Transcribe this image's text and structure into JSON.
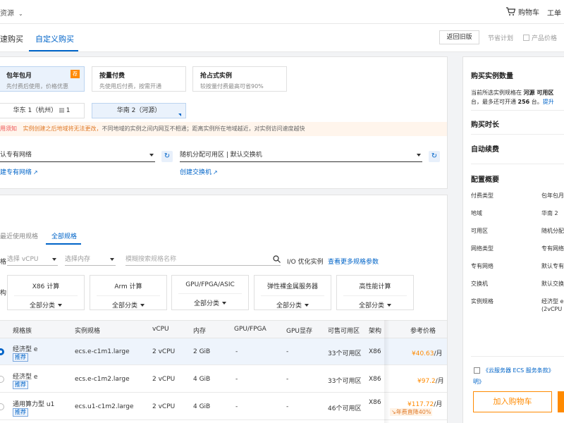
{
  "topbar": {
    "resource_label": "资源",
    "cart_label": "购物车",
    "work_label": "工单"
  },
  "tabs": {
    "quick_buy": "速购买",
    "custom_buy": "自定义购买",
    "back_old": "返回旧版",
    "saving_plan": "节省计划",
    "product_price": "产品价格"
  },
  "billing": {
    "options": [
      {
        "title": "包年包月",
        "subtitle": "先付费后使用，价格优惠",
        "badge": "荐"
      },
      {
        "title": "按量付费",
        "subtitle": "先使用后付费，按需开通"
      },
      {
        "title": "抢占式实例",
        "subtitle": "较按量付费最高可省90%"
      }
    ]
  },
  "regions": {
    "east1": "华东 1（杭州）",
    "east1_badge": "1",
    "south2": "华南 2（河源）"
  },
  "notice": {
    "label": "用须知",
    "warn": "实例创建之后地域将无法更改，",
    "text": "不同地域的实例之间内网互不相通；距离实例所在地域越近，对实例访问速度越快"
  },
  "network": {
    "vpc_value": "认专有网络",
    "zone_value": "随机分配可用区 | 默认交换机",
    "create_vpc": "建专有网络",
    "create_switch": "创建交换机"
  },
  "spec_tabs": {
    "recent": "最近使用规格",
    "all": "全部规格"
  },
  "filters": {
    "vcpu_placeholder": "选择 vCPU",
    "mem_placeholder": "选择内存",
    "search_placeholder": "模糊搜索规格名称",
    "io_label": "I/O 优化实例",
    "more_params": "查看更多规格参数"
  },
  "categories": [
    {
      "title": "X86 计算",
      "sub": "全部分类"
    },
    {
      "title": "Arm 计算",
      "sub": "全部分类"
    },
    {
      "title": "GPU/FPGA/ASIC",
      "sub": "全部分类"
    },
    {
      "title": "弹性裸金属服务器",
      "sub": "全部分类"
    },
    {
      "title": "高性能计算",
      "sub": "全部分类"
    }
  ],
  "table": {
    "headers": [
      "规格族",
      "实例规格",
      "vCPU",
      "内存",
      "GPU/FPGA",
      "GPU显存",
      "可售可用区",
      "架构",
      "参考价格"
    ],
    "rows": [
      {
        "family": "经济型 e",
        "tag": "推荐",
        "spec": "ecs.e-c1m1.large",
        "vcpu": "2 vCPU",
        "mem": "2 GiB",
        "gpu": "-",
        "gpumem": "-",
        "zones": "33个可用区",
        "arch": "X86",
        "price": "¥40.63",
        "unit": "/月",
        "selected": true
      },
      {
        "family": "经济型 e",
        "tag": "推荐",
        "spec": "ecs.e-c1m2.large",
        "vcpu": "2 vCPU",
        "mem": "4 GiB",
        "gpu": "-",
        "gpumem": "-",
        "zones": "33个可用区",
        "arch": "X86",
        "price": "¥97.2",
        "unit": "/月",
        "selected": false
      },
      {
        "family": "通用算力型 u1",
        "tag": "推荐",
        "spec": "ecs.u1-c1m2.large",
        "vcpu": "2 vCPU",
        "mem": "4 GiB",
        "gpu": "-",
        "gpumem": "-",
        "zones": "46个可用区",
        "arch": "X86",
        "price": "¥117.72",
        "unit": "/月",
        "promo": "年费直降40%",
        "selected": false
      }
    ]
  },
  "summary": {
    "qty_title": "购买实例数量",
    "qty_line1_pre": "当前所选实例规格在 ",
    "qty_line1_region": "河源 可用区",
    "qty_line2_pre": "台，最多还可开通 ",
    "qty_line2_num": "256",
    "qty_line2_mid": " 台。",
    "qty_line2_link": "提升",
    "duration": "购买时长",
    "auto_renew": "自动续费",
    "overview": "配置概要",
    "items": [
      {
        "label": "付费类型",
        "value": "包年包月"
      },
      {
        "label": "地域",
        "value": "华南 2"
      },
      {
        "label": "可用区",
        "value": "随机分配"
      },
      {
        "label": "网络类型",
        "value": "专有网络"
      },
      {
        "label": "专有网络",
        "value": "默认专有"
      },
      {
        "label": "交换机",
        "value": "默认交换"
      },
      {
        "label": "实例规格",
        "value": "经济型 e",
        "value2": "(2vCPU"
      }
    ],
    "terms_text": "《云服务器 ECS 服务条款》",
    "terms_line2": "明》",
    "add_cart": "加入购物车"
  },
  "colors": {
    "accent": "#0064c8",
    "price": "#ff8a00",
    "selected_bg": "#eaf2fc",
    "warn": "#e07b2a"
  }
}
